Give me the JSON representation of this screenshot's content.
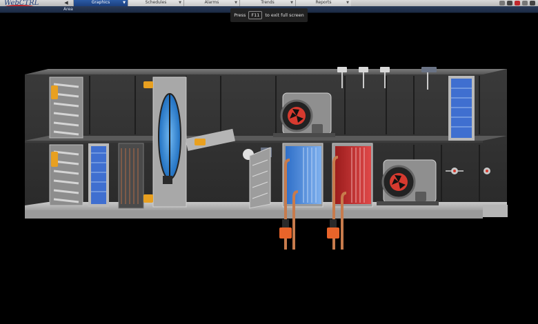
{
  "app": {
    "logo_text": "WebCTRL"
  },
  "nav": {
    "back_icon": "back-arrow-icon",
    "tabs": [
      {
        "label": "Graphics",
        "active": true
      },
      {
        "label": "Schedules",
        "active": false
      },
      {
        "label": "Alarms",
        "active": false
      },
      {
        "label": "Trends",
        "active": false
      },
      {
        "label": "Reports",
        "active": false
      }
    ],
    "tool_icons": [
      "print-icon",
      "help-icon",
      "alarm-icon",
      "logout-icon",
      "close-icon"
    ]
  },
  "area_bar": {
    "label": "Area"
  },
  "fullscreen_message": {
    "press": "Press",
    "key": "F11",
    "suffix": "to exit full screen"
  },
  "colors": {
    "active_tab": "#2b5aa5",
    "area_bar": "#22324d",
    "cooling_coil": "#2f6fc8",
    "heating_coil": "#c92a2a",
    "fan_motor": "#d63a2f",
    "filter": "#3f6fd0",
    "damper_actuator": "#e8a020",
    "piping": "#c77b4c"
  }
}
